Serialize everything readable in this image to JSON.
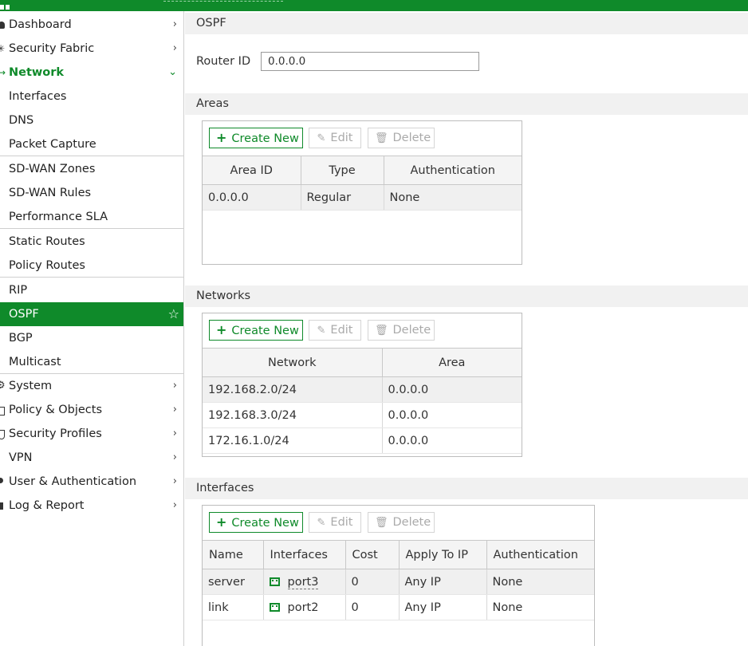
{
  "sidebar": {
    "items": [
      {
        "label": "Dashboard"
      },
      {
        "label": "Security Fabric"
      },
      {
        "label": "Network"
      },
      {
        "label": "Interfaces"
      },
      {
        "label": "DNS"
      },
      {
        "label": "Packet Capture"
      },
      {
        "label": "SD-WAN Zones"
      },
      {
        "label": "SD-WAN Rules"
      },
      {
        "label": "Performance SLA"
      },
      {
        "label": "Static Routes"
      },
      {
        "label": "Policy Routes"
      },
      {
        "label": "RIP"
      },
      {
        "label": "OSPF"
      },
      {
        "label": "BGP"
      },
      {
        "label": "Multicast"
      },
      {
        "label": "System"
      },
      {
        "label": "Policy & Objects"
      },
      {
        "label": "Security Profiles"
      },
      {
        "label": "VPN"
      },
      {
        "label": "User & Authentication"
      },
      {
        "label": "Log & Report"
      }
    ]
  },
  "page": {
    "title": "OSPF",
    "router_id_label": "Router ID",
    "router_id_value": "0.0.0.0"
  },
  "toolbar": {
    "create_label": "Create New",
    "edit_label": "Edit",
    "delete_label": "Delete"
  },
  "areas": {
    "title": "Areas",
    "columns": [
      "Area ID",
      "Type",
      "Authentication"
    ],
    "rows": [
      [
        "0.0.0.0",
        "Regular",
        "None"
      ]
    ]
  },
  "networks": {
    "title": "Networks",
    "columns": [
      "Network",
      "Area"
    ],
    "rows": [
      [
        "192.168.2.0/24",
        "0.0.0.0"
      ],
      [
        "192.168.3.0/24",
        "0.0.0.0"
      ],
      [
        "172.16.1.0/24",
        "0.0.0.0"
      ]
    ]
  },
  "interfaces": {
    "title": "Interfaces",
    "columns": [
      "Name",
      "Interfaces",
      "Cost",
      "Apply To IP",
      "Authentication"
    ],
    "rows": [
      [
        "server",
        "port3",
        "0",
        "Any IP",
        "None"
      ],
      [
        "link",
        "port2",
        "0",
        "Any IP",
        "None"
      ]
    ]
  },
  "colors": {
    "brand_green": "#0f8a2a"
  }
}
